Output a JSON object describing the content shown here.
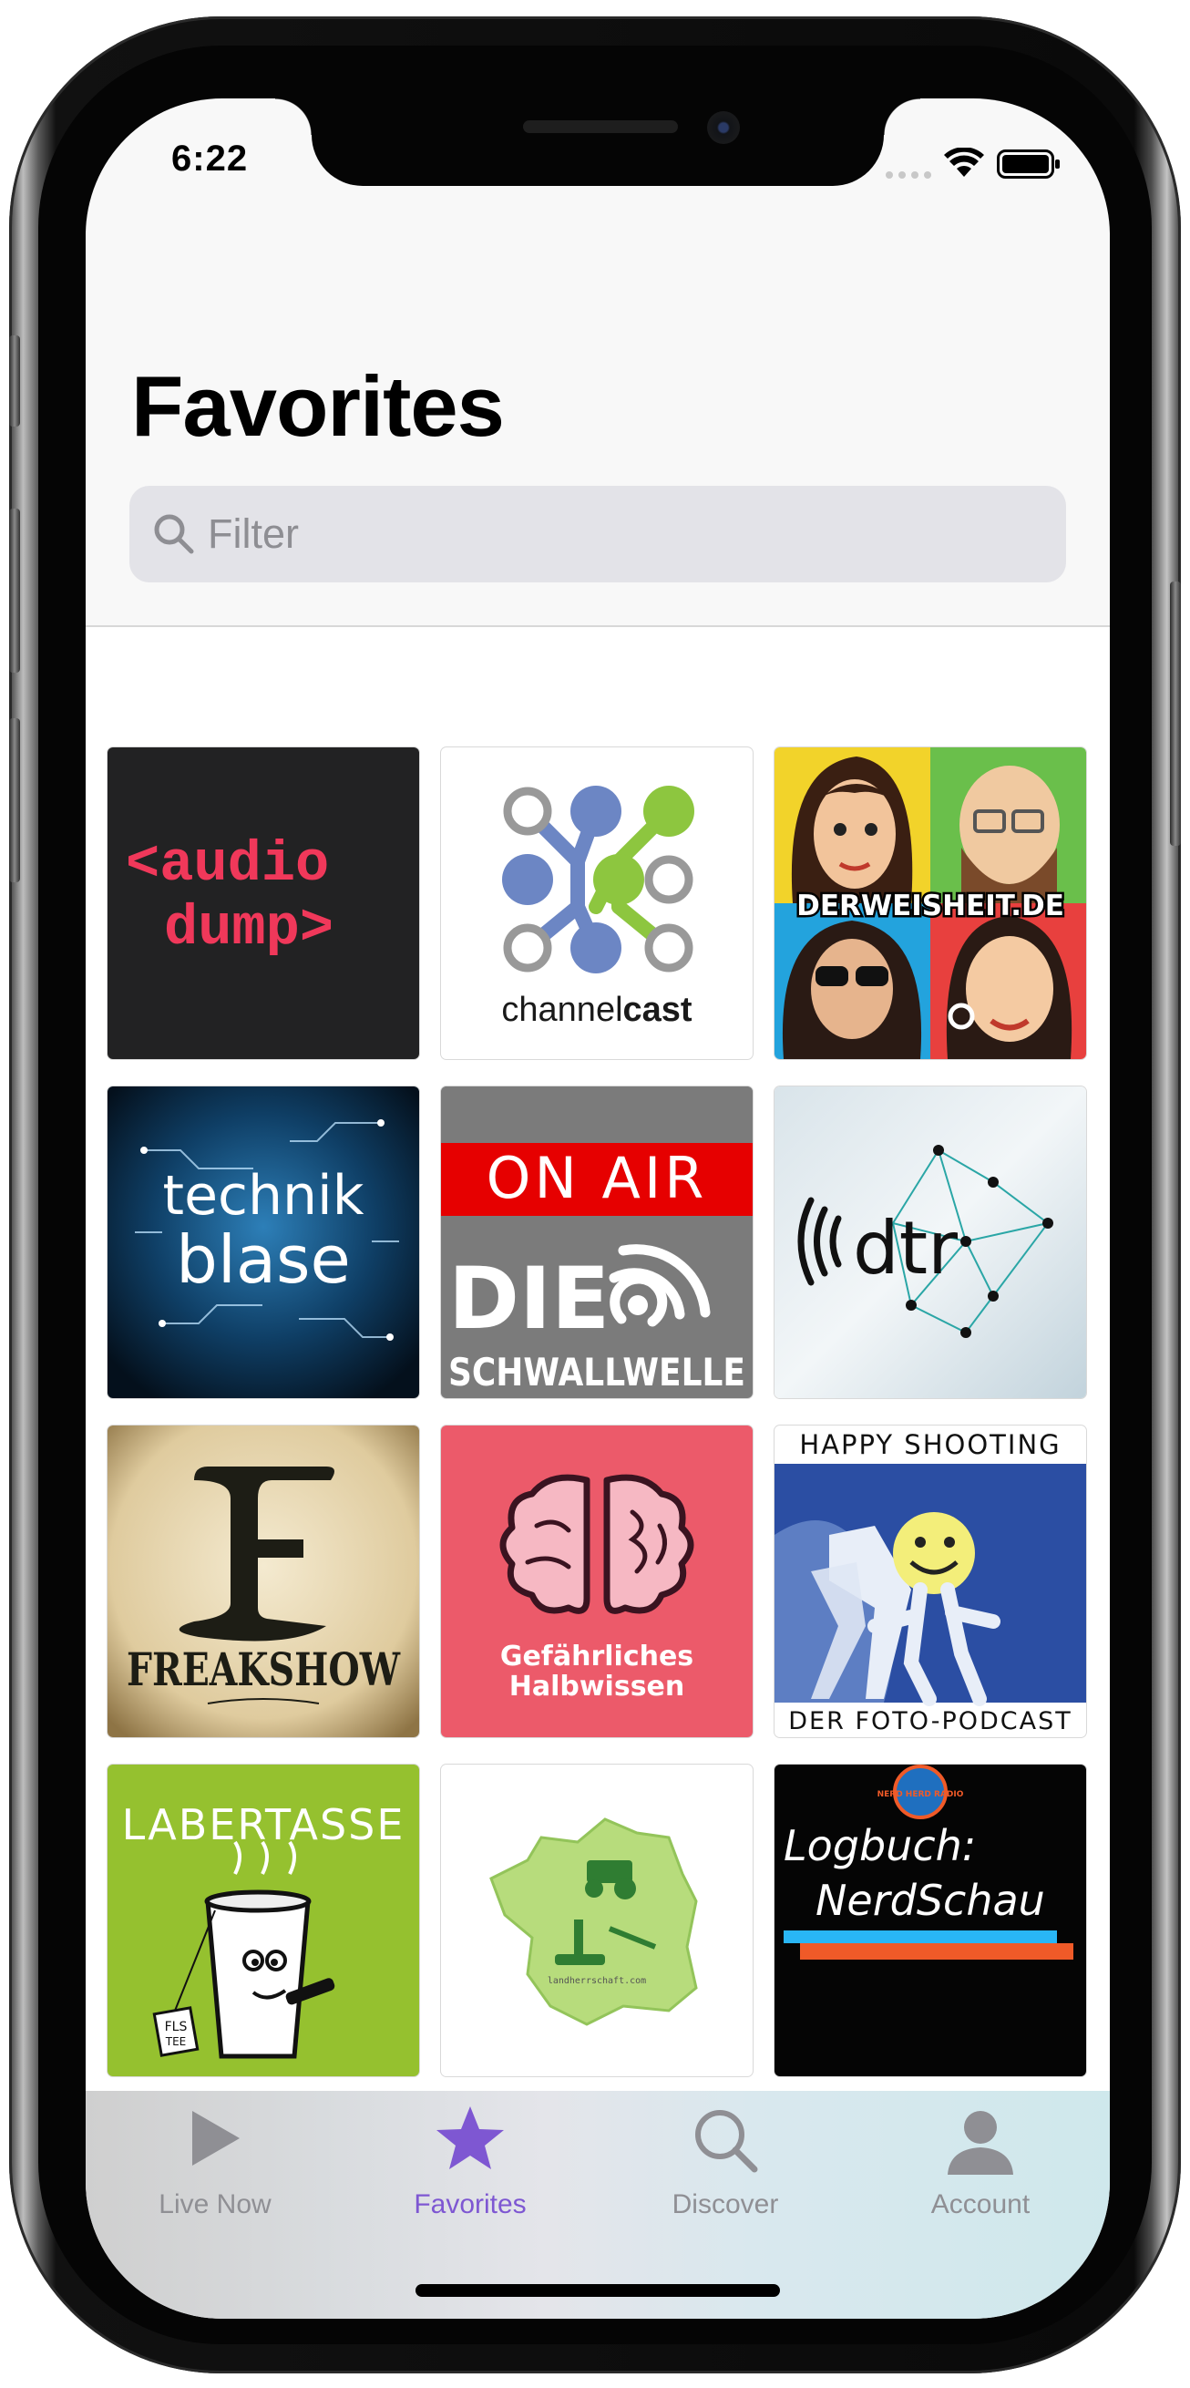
{
  "status_bar": {
    "time": "6:22"
  },
  "header": {
    "title": "Favorites"
  },
  "search": {
    "placeholder": "Filter"
  },
  "podcasts": [
    {
      "name": "audiodump",
      "line1": "<audio",
      "line2": "dump>"
    },
    {
      "name": "channelcast",
      "text": "channelcast",
      "text_a": "channel",
      "text_b": "cast"
    },
    {
      "name": "derweisheit",
      "text": "DERWEISHEIT.DE"
    },
    {
      "name": "technikblase",
      "line1": "technik",
      "line2": "blase"
    },
    {
      "name": "schwallwelle",
      "on_air": "ON AIR",
      "line1": "DIE",
      "line2": "SCHWALLWELLE"
    },
    {
      "name": "dtr",
      "text": "dtr"
    },
    {
      "name": "freakshow",
      "text": "FREAKSHOW"
    },
    {
      "name": "gefaehrliches-halbwissen",
      "line1": "Gefährliches",
      "line2": "Halbwissen"
    },
    {
      "name": "happy-shooting",
      "top": "HAPPY SHOOTING",
      "bottom": "DER FOTO-PODCAST"
    },
    {
      "name": "labertasse",
      "text": "LABERTASSE",
      "tag": "FLS",
      "tag2": "TEE"
    },
    {
      "name": "landherrschaft",
      "text": "landherrschaft.com"
    },
    {
      "name": "logbuch-nerdschau",
      "line1": "Logbuch:",
      "line2": "NerdSchau",
      "badge": "NERD HERD RADIO"
    },
    {
      "name": "partial-black"
    },
    {
      "name": "partial-blue"
    },
    {
      "name": "partial-teal"
    }
  ],
  "tabs": [
    {
      "label": "Live Now",
      "icon": "play-icon",
      "active": false
    },
    {
      "label": "Favorites",
      "icon": "star-icon",
      "active": true
    },
    {
      "label": "Discover",
      "icon": "magnifier-icon",
      "active": false
    },
    {
      "label": "Account",
      "icon": "person-icon",
      "active": false
    }
  ],
  "colors": {
    "accent": "#7e57d2",
    "inactive": "#8f8f94",
    "audiodump_red": "#f0385a",
    "halbwissen_bg": "#ec5a6a",
    "labertasse_green": "#95c12f"
  }
}
